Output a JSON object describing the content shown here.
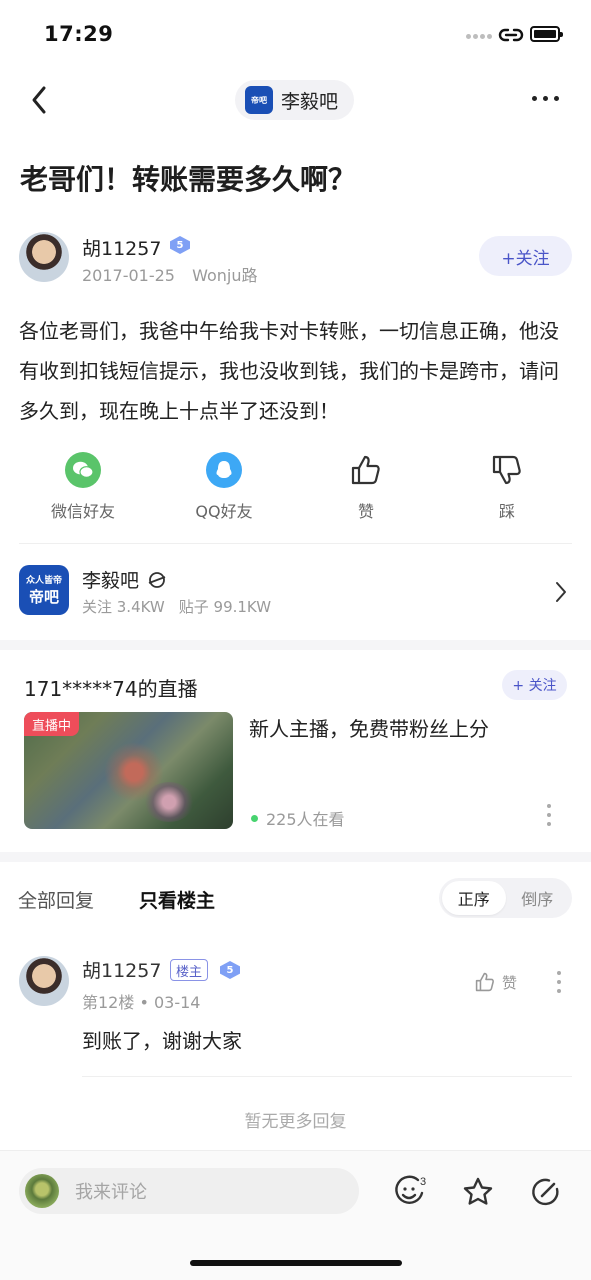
{
  "status_bar": {
    "time": "17:29"
  },
  "nav": {
    "forum_pill_name": "李毅吧",
    "forum_logo_text": "帝吧"
  },
  "post": {
    "title": "老哥们！转账需要多久啊？",
    "author": {
      "name": "胡11257",
      "level": "5",
      "date": "2017-01-25",
      "location": "Wonju路"
    },
    "follow_label": "+关注",
    "body": "各位老哥们，我爸中午给我卡对卡转账，一切信息正确，他没有收到扣钱短信提示，我也没收到钱，我们的卡是跨市，请问多久到，现在晚上十点半了还没到！"
  },
  "actions": [
    {
      "label": "微信好友",
      "icon": "wechat-icon"
    },
    {
      "label": "QQ好友",
      "icon": "qq-icon"
    },
    {
      "label": "赞",
      "icon": "thumbs-up-icon"
    },
    {
      "label": "踩",
      "icon": "thumbs-down-icon"
    }
  ],
  "forum": {
    "name": "李毅吧",
    "logo_line1": "众人皆帝",
    "logo_line2": "帝吧",
    "followers": "关注 3.4KW",
    "posts": "贴子 99.1KW"
  },
  "live": {
    "title": "171*****74的直播",
    "follow_label": "+ 关注",
    "badge": "直播中",
    "description": "新人主播，免费带粉丝上分",
    "viewers": "225人在看"
  },
  "reply_tabs": {
    "all": "全部回复",
    "op_only": "只看楼主",
    "sort_asc": "正序",
    "sort_desc": "倒序"
  },
  "reply": {
    "name": "胡11257",
    "op_tag": "楼主",
    "level": "5",
    "meta": "第12楼 • 03-14",
    "like_label": "赞",
    "text": "到账了，谢谢大家"
  },
  "no_more": "暂无更多回复",
  "bottom": {
    "comment_placeholder": "我来评论",
    "emoji_count": "3"
  },
  "colors": {
    "accent": "#4a55c8",
    "live_red": "#ee4d5a",
    "online_green": "#47d36f"
  }
}
